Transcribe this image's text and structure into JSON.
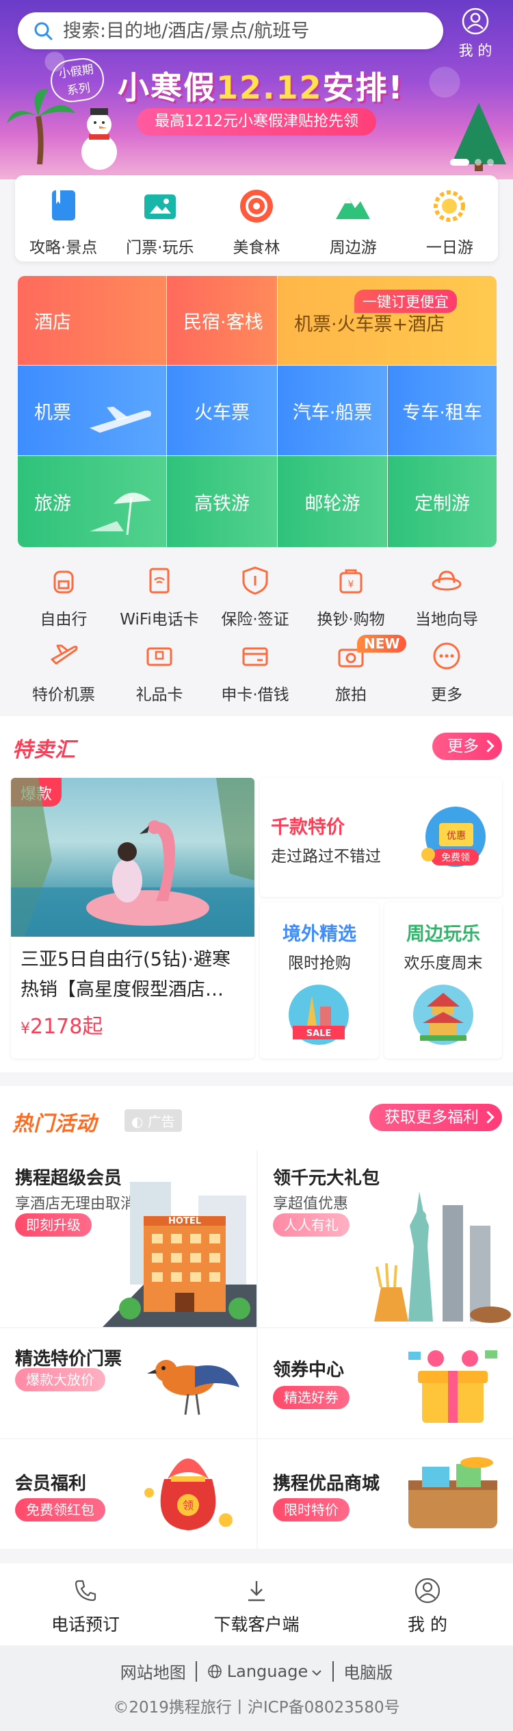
{
  "search": {
    "placeholder": "搜索:目的地/酒店/景点/航班号"
  },
  "header": {
    "my_label": "我 的"
  },
  "banner": {
    "badge_line1": "小假期",
    "badge_line2": "系列",
    "title_part1": "小寒假",
    "title_num": "12.12",
    "title_part2": "安排!",
    "subtitle": "最高1212元小寒假津贴抢先领"
  },
  "quick_nav": [
    {
      "label": "攻略·景点",
      "icon": "guide-book-icon",
      "color": "#2f8ff0"
    },
    {
      "label": "门票·玩乐",
      "icon": "ticket-icon",
      "color": "#18b5a9"
    },
    {
      "label": "美食林",
      "icon": "food-icon",
      "color": "#ff5a3c"
    },
    {
      "label": "周边游",
      "icon": "mountain-icon",
      "color": "#2fc27a"
    },
    {
      "label": "一日游",
      "icon": "sun-icon",
      "color": "#ffb82e"
    }
  ],
  "grid": {
    "hotel": "酒店",
    "homestay": "民宿·客栈",
    "flight_train_hotel": "机票·火车票+酒店",
    "hot_tag": "一键订更便宜",
    "flight": "机票",
    "train": "火车票",
    "bus_ship": "汽车·船票",
    "car_rental": "专车·租车",
    "travel": "旅游",
    "highspeed": "高铁游",
    "cruise": "邮轮游",
    "custom": "定制游"
  },
  "services": [
    {
      "label": "自由行",
      "icon": "backpack-icon"
    },
    {
      "label": "WiFi电话卡",
      "icon": "wifi-card-icon"
    },
    {
      "label": "保险·签证",
      "icon": "shield-icon"
    },
    {
      "label": "换钞·购物",
      "icon": "shopping-bag-icon"
    },
    {
      "label": "当地向导",
      "icon": "guide-hat-icon"
    },
    {
      "label": "特价机票",
      "icon": "plane-icon"
    },
    {
      "label": "礼品卡",
      "icon": "gift-card-icon"
    },
    {
      "label": "申卡·借钱",
      "icon": "credit-card-icon"
    },
    {
      "label": "旅拍",
      "icon": "camera-icon",
      "badge": "NEW"
    },
    {
      "label": "更多",
      "icon": "more-dots-icon"
    }
  ],
  "deals": {
    "section_title": "特卖汇",
    "more": "更多",
    "main_tag": "爆款",
    "main_title": "三亚5日自由行(5钻)·避寒热销【高星度假型酒店…",
    "main_price_symbol": "¥",
    "main_price": "2178",
    "main_price_suffix": "起",
    "side1_title": "千款特价",
    "side1_sub": "走过路过不错过",
    "side1_badge_top": "优惠",
    "side1_badge_bottom": "免费领",
    "side2_title": "境外精选",
    "side2_sub": "限时抢购",
    "side2_badge": "SALE",
    "side3_title": "周边玩乐",
    "side3_sub": "欢乐度周末"
  },
  "activities": {
    "section_title": "热门活动",
    "ad_label": "广告",
    "more": "获取更多福利",
    "items": [
      {
        "title": "携程超级会员",
        "sub": "享酒店无理由取消",
        "btn": "即刻升级",
        "image_text": "HOTEL"
      },
      {
        "title": "领千元大礼包",
        "sub": "享超值优惠",
        "btn": "人人有礼"
      },
      {
        "title": "精选特价门票",
        "btn": "爆款大放价"
      },
      {
        "title": "领券中心",
        "btn": "精选好券"
      },
      {
        "title": "会员福利",
        "btn": "免费领红包",
        "image_text": "领"
      },
      {
        "title": "携程优品商城",
        "btn": "限时特价"
      }
    ]
  },
  "bottom_bar": [
    {
      "label": "电话预订",
      "icon": "phone-icon"
    },
    {
      "label": "下载客户端",
      "icon": "download-icon"
    },
    {
      "label": "我 的",
      "icon": "user-icon"
    }
  ],
  "footer": {
    "sitemap": "网站地图",
    "language": "Language",
    "desktop": "电脑版",
    "copyright": "©2019携程旅行丨沪ICP备08023580号"
  }
}
